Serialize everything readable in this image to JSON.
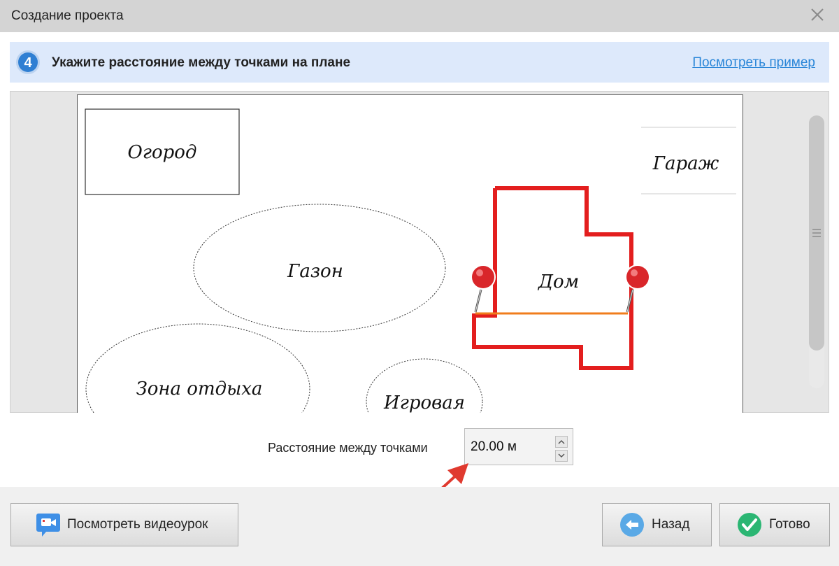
{
  "window": {
    "title": "Создание проекта"
  },
  "step": {
    "number": "4",
    "title": "Укажите расстояние между точками на плане",
    "example_link": "Посмотреть пример"
  },
  "plan": {
    "labels": {
      "garden": "Огород",
      "garage": "Гараж",
      "lawn": "Газон",
      "house": "Дом",
      "rest_zone": "Зона отдыха",
      "playground": "Игровая"
    }
  },
  "distance": {
    "label": "Расстояние между точками",
    "value": "20.00 м"
  },
  "buttons": {
    "video": "Посмотреть видеоурок",
    "back": "Назад",
    "done": "Готово"
  },
  "colors": {
    "accent_blue": "#2a86d8",
    "house_outline": "#e31e1e",
    "measure_line": "#f07d1c",
    "pin_red": "#d9262a",
    "done_green": "#2bb673",
    "annotation_arrow": "#e03a2f"
  },
  "icons": {
    "close": "close-icon",
    "step_badge": "step-number-badge",
    "pin": "map-pin-icon",
    "video": "video-camera-icon",
    "back": "arrow-left-icon",
    "done": "checkmark-icon",
    "spin_up": "chevron-up-icon",
    "spin_down": "chevron-down-icon"
  }
}
